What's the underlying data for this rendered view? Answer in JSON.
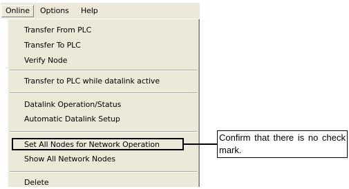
{
  "menubar": {
    "items": [
      {
        "label": "Online",
        "active": true
      },
      {
        "label": "Options"
      },
      {
        "label": "Help"
      }
    ]
  },
  "dropdown": {
    "items": [
      "Transfer From PLC",
      "Transfer To PLC",
      "Verify Node",
      "Transfer to PLC while datalink active",
      "Datalink Operation/Status",
      "Automatic Datalink Setup",
      "Set All Nodes for Network Operation",
      "Show All Network Nodes",
      "Delete"
    ]
  },
  "callout": {
    "text": "Confirm that there is no check mark."
  },
  "colors": {
    "menu_background": "#ece9d8",
    "separator_dark": "#aca899",
    "annotation": "#000000"
  }
}
